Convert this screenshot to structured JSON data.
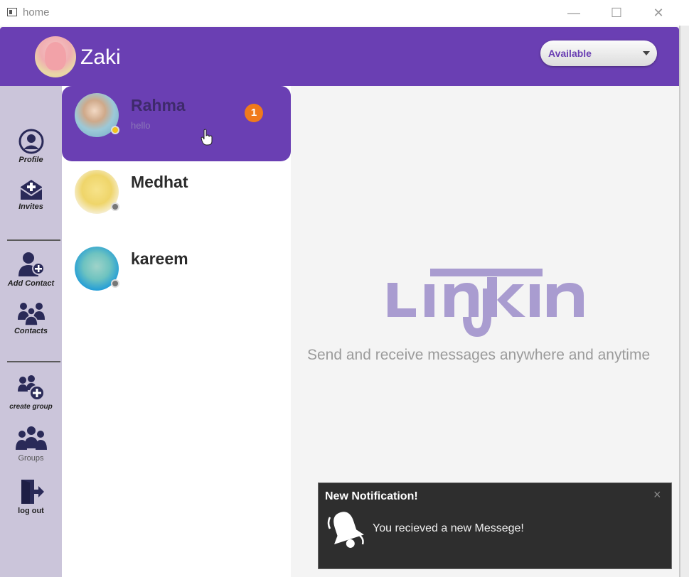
{
  "window": {
    "title": "home",
    "minimize": "—",
    "maximize": "☐",
    "close": "✕"
  },
  "header": {
    "username": "Zaki",
    "status_value": "Available",
    "avatar_icon": "patrick-avatar"
  },
  "sidebar": {
    "items": [
      {
        "label": "Profile",
        "icon": "user-circle-icon"
      },
      {
        "label": "Invites",
        "icon": "envelope-plus-icon"
      },
      {
        "label": "Add Contact",
        "icon": "user-add-icon"
      },
      {
        "label": "Contacts",
        "icon": "users-icon"
      },
      {
        "label": "create group",
        "icon": "group-add-icon"
      },
      {
        "label": "Groups",
        "icon": "groups-icon"
      },
      {
        "label": "log out",
        "icon": "logout-icon"
      }
    ]
  },
  "contacts": [
    {
      "name": "Rahma",
      "last_message": "hello",
      "unread": "1",
      "status_color": "#f4c21c",
      "active": true
    },
    {
      "name": "Medhat",
      "last_message": "",
      "unread": "",
      "status_color": "#777777",
      "active": false
    },
    {
      "name": "kareem",
      "last_message": "",
      "unread": "",
      "status_color": "#777777",
      "active": false
    }
  ],
  "main": {
    "logo_text": "Linkin",
    "tagline": "Send and receive messages anywhere and anytime"
  },
  "notification": {
    "title": "New Notification!",
    "message": "You recieved a new Messege!",
    "close": "×"
  },
  "colors": {
    "brand": "#6a3fb3",
    "sidebar": "#cbc5da",
    "badge": "#f07a1b",
    "logo": "#a99cd0"
  }
}
